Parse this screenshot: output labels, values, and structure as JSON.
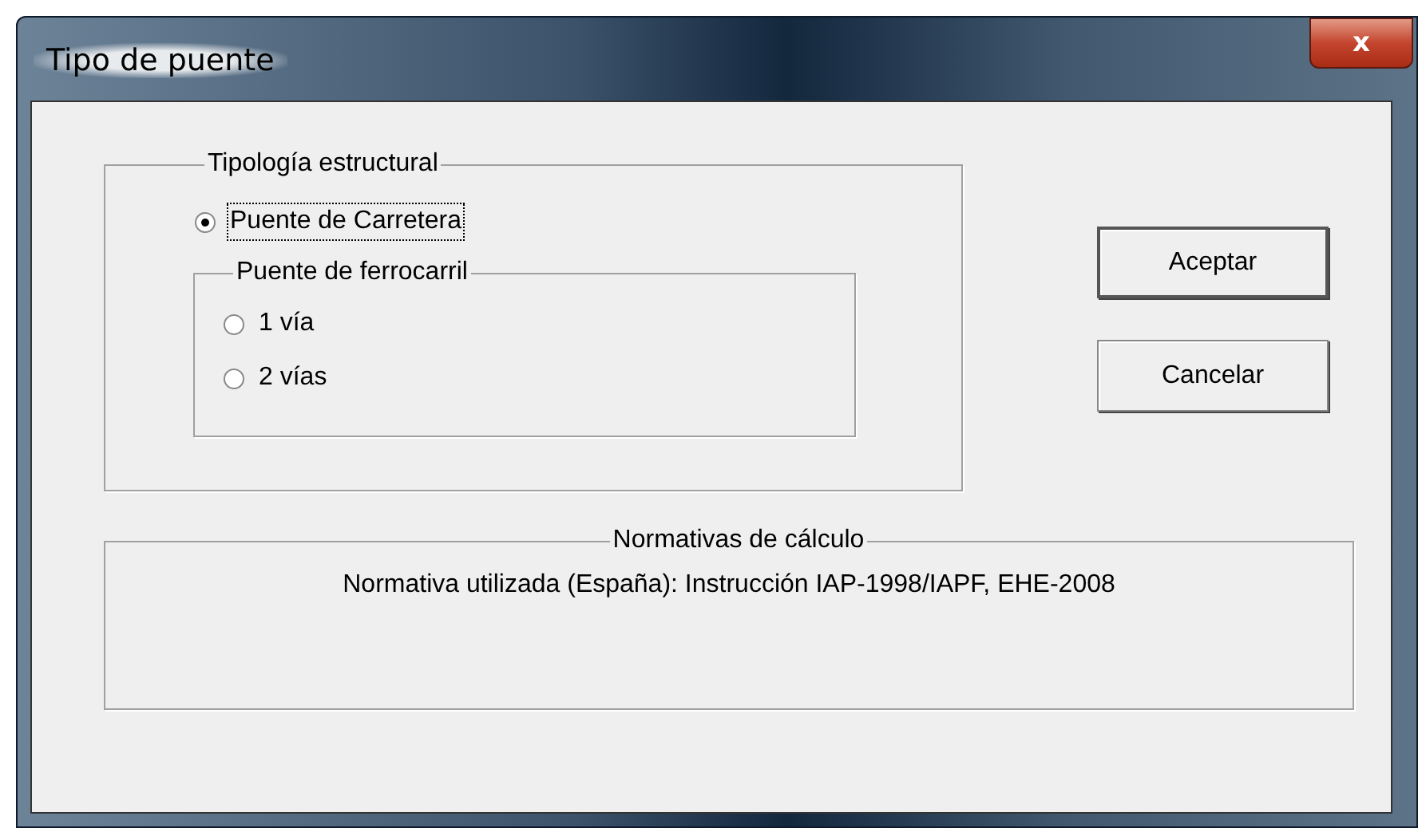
{
  "window": {
    "title": "Tipo de puente",
    "close_label": "x"
  },
  "structure_group": {
    "legend": "Tipología estructural",
    "road_option": {
      "label": "Puente de Carretera",
      "selected": true,
      "focused": true
    },
    "rail_group": {
      "legend": "Puente de ferrocarril",
      "options": [
        {
          "label": "1 vía",
          "selected": false
        },
        {
          "label": "2 vías",
          "selected": false
        }
      ]
    }
  },
  "buttons": [
    {
      "label": "Aceptar",
      "default": true
    },
    {
      "label": "Cancelar",
      "default": false
    }
  ],
  "standards_group": {
    "legend": "Normativas de cálculo",
    "text": "Normativa utilizada (España): Instrucción IAP-1998/IAPF, EHE-2008"
  }
}
